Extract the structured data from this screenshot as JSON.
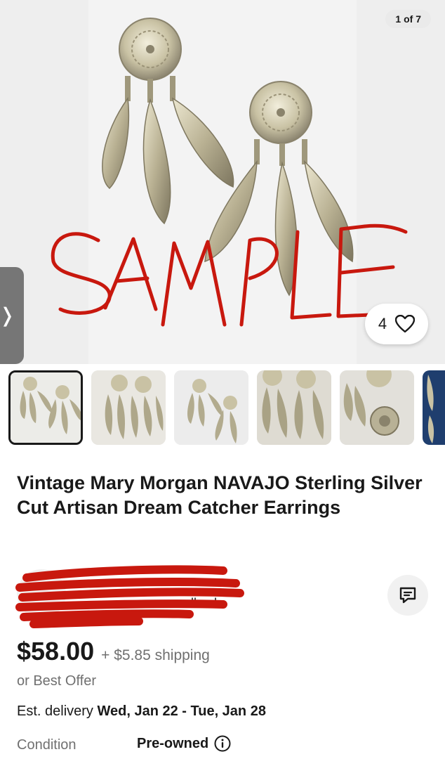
{
  "gallery": {
    "counter": "1 of 7",
    "watchers": "4",
    "watermark": "SAMPLE"
  },
  "thumbnails": [
    {
      "label": "photo 1"
    },
    {
      "label": "photo 2"
    },
    {
      "label": "photo 3"
    },
    {
      "label": "photo 4"
    },
    {
      "label": "photo 5"
    },
    {
      "label": "photo 6"
    }
  ],
  "listing": {
    "title": "Vintage Mary Morgan NAVAJO Sterling Silver Cut Artisan Dream Catcher Earrings"
  },
  "seller": {
    "feedback_partial": "edback"
  },
  "pricing": {
    "price": "$58.00",
    "shipping": "+ $5.85 shipping",
    "best_offer": "or Best Offer"
  },
  "delivery": {
    "label": "Est. delivery",
    "dates": "Wed, Jan 22 - Tue, Jan 28"
  },
  "condition": {
    "label": "Condition",
    "value": "Pre-owned"
  },
  "colors": {
    "text": "#191919",
    "muted": "#707070",
    "redact": "#c8180e",
    "silver": "#b8b196"
  }
}
